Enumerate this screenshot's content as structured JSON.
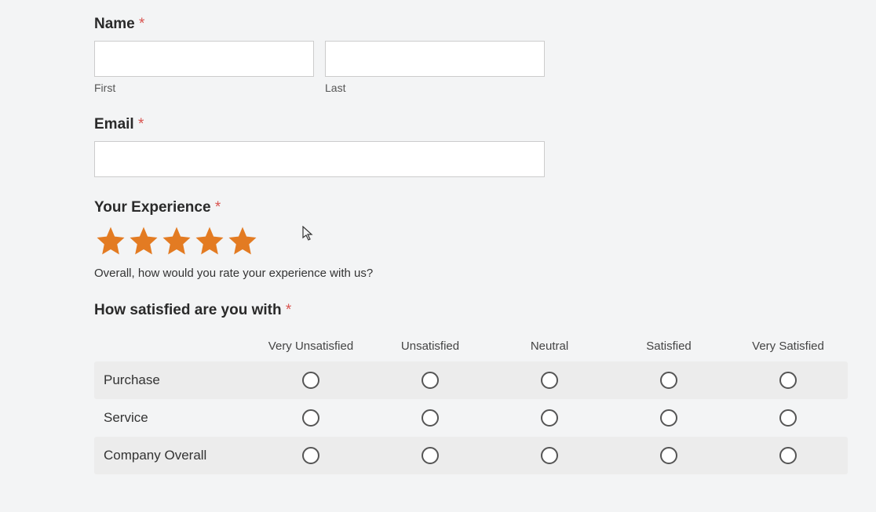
{
  "name": {
    "label": "Name",
    "required": "*",
    "first_sublabel": "First",
    "last_sublabel": "Last",
    "first_value": "",
    "last_value": ""
  },
  "email": {
    "label": "Email",
    "required": "*",
    "value": ""
  },
  "experience": {
    "label": "Your Experience",
    "required": "*",
    "rating": 5,
    "description": "Overall, how would you rate your experience with us?"
  },
  "satisfaction": {
    "label": "How satisfied are you with",
    "required": "*",
    "columns": [
      "Very Unsatisfied",
      "Unsatisfied",
      "Neutral",
      "Satisfied",
      "Very Satisfied"
    ],
    "rows": [
      "Purchase",
      "Service",
      "Company Overall"
    ]
  }
}
